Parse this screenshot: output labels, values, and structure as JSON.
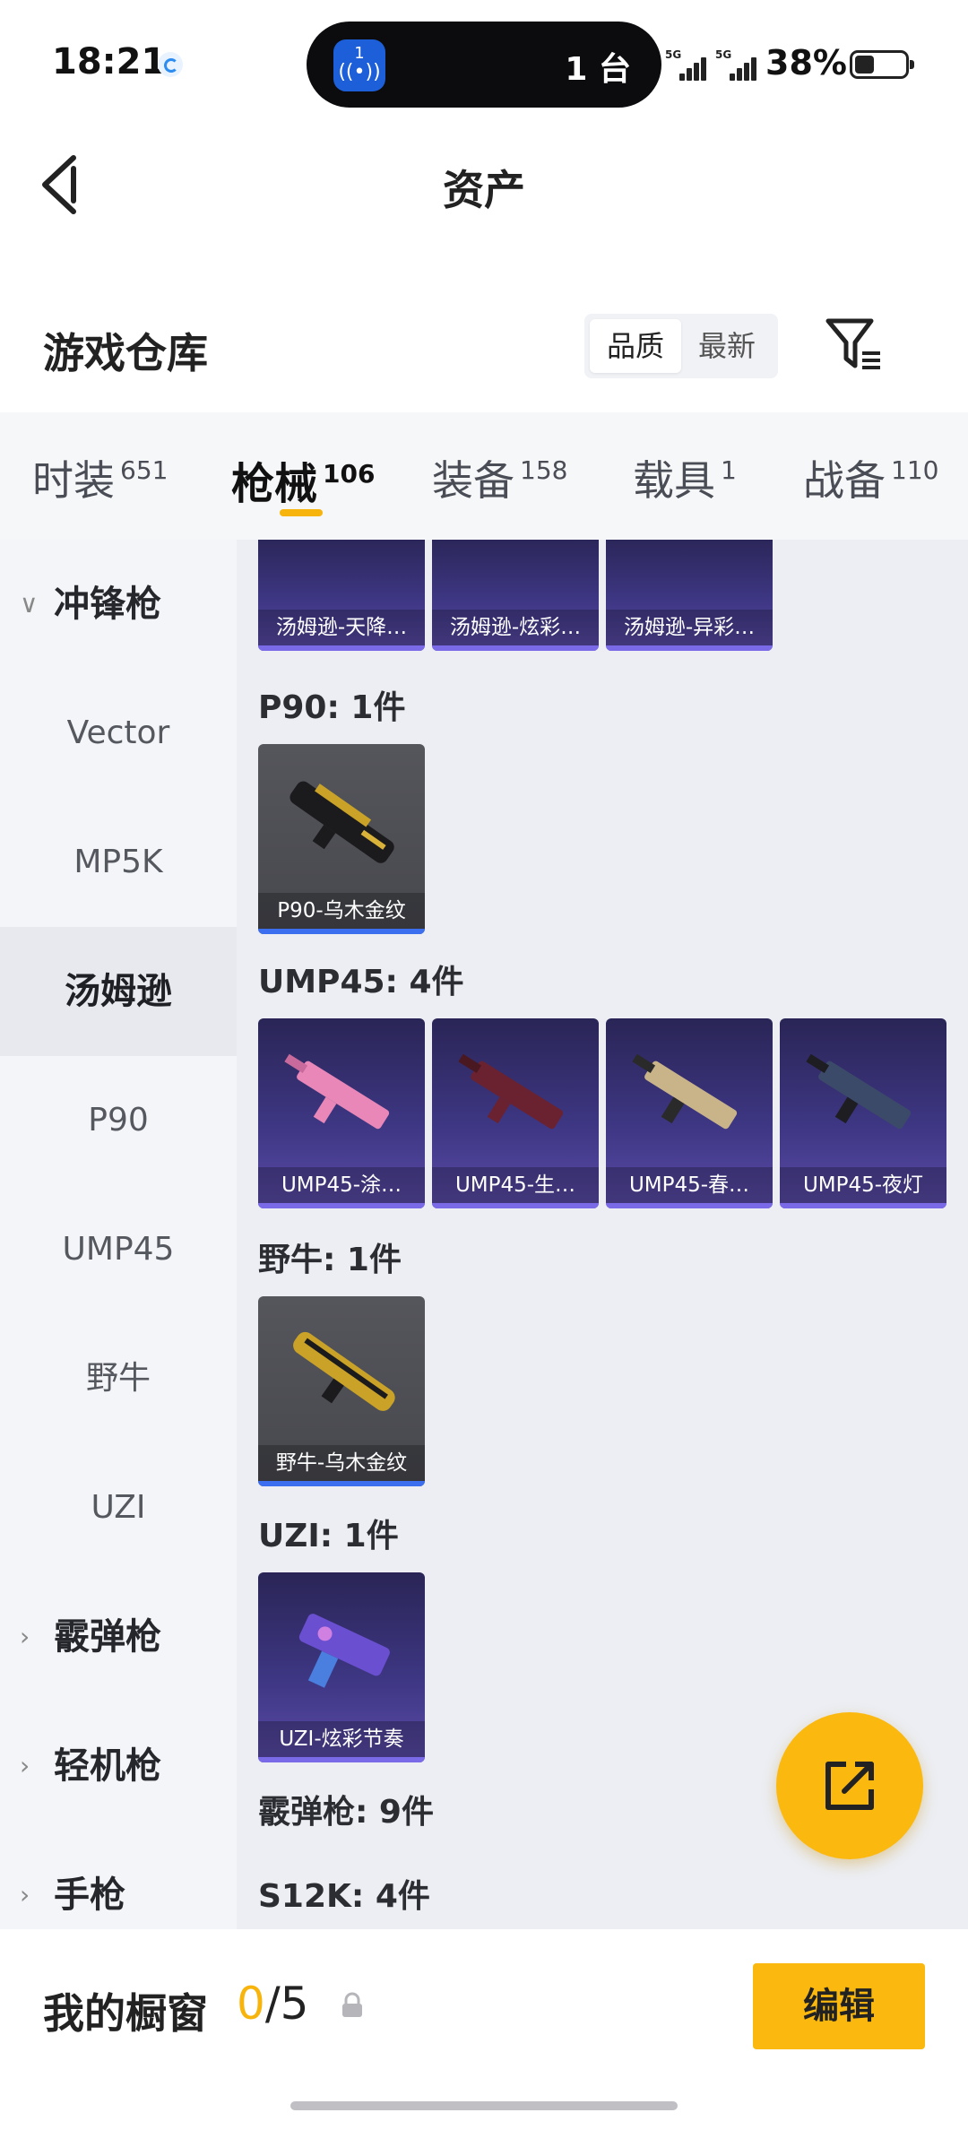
{
  "status_bar": {
    "time": "18:21",
    "island_badge": "1",
    "island_text": "1 台",
    "network_1": "5G",
    "network_2": "5G",
    "battery": "38%",
    "battery_level": 0.38
  },
  "header": {
    "title": "资产"
  },
  "warehouse": {
    "title": "游戏仓库",
    "sort_options": [
      "品质",
      "最新"
    ],
    "sort_selected": "品质"
  },
  "tabs": [
    {
      "label": "时装",
      "count": "651"
    },
    {
      "label": "枪械",
      "count": "106",
      "active": true
    },
    {
      "label": "装备",
      "count": "158"
    },
    {
      "label": "载具",
      "count": "1"
    },
    {
      "label": "战备",
      "count": "110"
    }
  ],
  "sidebar": [
    {
      "label": "冲锋枪",
      "type": "group",
      "expanded": true
    },
    {
      "label": "Vector"
    },
    {
      "label": "MP5K"
    },
    {
      "label": "汤姆逊",
      "active": true
    },
    {
      "label": "P90"
    },
    {
      "label": "UMP45"
    },
    {
      "label": "野牛"
    },
    {
      "label": "UZI"
    },
    {
      "label": "霰弹枪",
      "type": "group"
    },
    {
      "label": "轻机枪",
      "type": "group"
    },
    {
      "label": "手枪",
      "type": "group"
    }
  ],
  "content": {
    "thompson_items": [
      "汤姆逊-天降…",
      "汤姆逊-炫彩…",
      "汤姆逊-异彩…"
    ],
    "groups": [
      {
        "label": "P90: 1件",
        "items": [
          "P90-乌木金纹"
        ],
        "style": "gray"
      },
      {
        "label": "UMP45: 4件",
        "items": [
          "UMP45-涂…",
          "UMP45-生…",
          "UMP45-春…",
          "UMP45-夜灯"
        ],
        "style": "purple"
      },
      {
        "label": "野牛: 1件",
        "items": [
          "野牛-乌木金纹"
        ],
        "style": "gray"
      },
      {
        "label": "UZI: 1件",
        "items": [
          "UZI-炫彩节奏"
        ],
        "style": "purple"
      }
    ],
    "shotgun_label": "霰弹枪: 9件",
    "s12k_label": "S12K: 4件"
  },
  "showcase": {
    "title": "我的橱窗",
    "current": "0",
    "total": "/5",
    "edit_label": "编辑"
  },
  "colors": {
    "accent": "#fbb80f",
    "sidebar_bg": "#f4f5f8",
    "content_bg": "#eceef3"
  }
}
